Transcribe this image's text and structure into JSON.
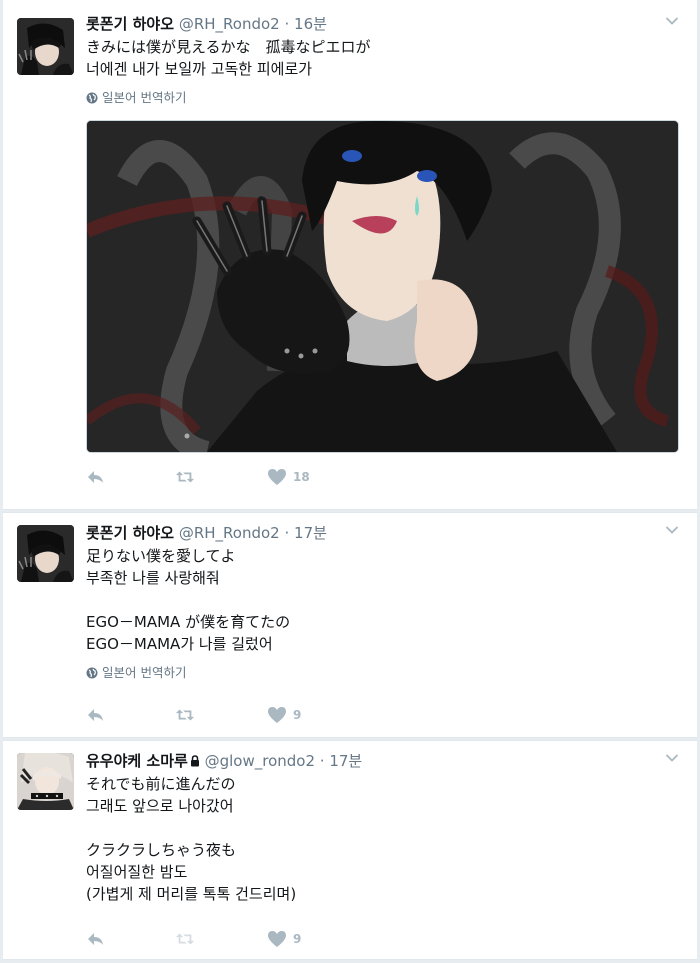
{
  "tweets": [
    {
      "fullname": "롯폰기 하야오",
      "username": "@RH_Rondo2",
      "time": "· 16분",
      "text": "きみには僕が見えるかな　孤毒なピエロが\n너에겐 내가 보일까 고독한 피에로가",
      "translate": "일본어 번역하기",
      "likes": "18",
      "protected": false,
      "has_media": true
    },
    {
      "fullname": "롯폰기 하야오",
      "username": "@RH_Rondo2",
      "time": "· 17분",
      "text": "足りない僕を愛してよ\n부족한 나를 사랑해줘\n\nEGO－MAMA が僕を育てたの\nEGO－MAMA가 나를 길렀어",
      "translate": "일본어 번역하기",
      "likes": "9",
      "protected": false,
      "has_media": false
    },
    {
      "fullname": "유우야케 소마루",
      "username": "@glow_rondo2",
      "time": "· 17분",
      "text": "それでも前に進んだの\n그래도 앞으로 나아갔어\n\nクラクラしちゃう夜も\n어질어질한 밤도\n(가볍게 제 머리를 톡톡 건드리며)",
      "likes": "9",
      "protected": true,
      "has_media": false
    }
  ],
  "icons": {
    "reply": "reply-icon",
    "retweet": "retweet-icon",
    "like": "heart-icon",
    "caret": "chevron-down-icon",
    "globe": "globe-icon",
    "lock": "lock-icon"
  },
  "colors": {
    "background": "#e6ecf0",
    "text": "#14171a",
    "muted": "#657786",
    "action": "#aab8c2"
  }
}
